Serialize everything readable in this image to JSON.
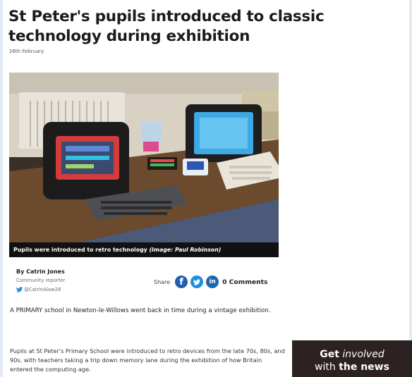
{
  "article": {
    "headline": "St Peter's pupils introduced to classic technology during exhibition",
    "date": "26th February",
    "caption_text": "Pupils were introduced to retro technology",
    "caption_credit": "(Image: Paul Robinson)",
    "author_name": "By Catrin Jones",
    "author_role": "Community reporter",
    "author_twitter": "@CatrinAlaw28",
    "share_label": "Share",
    "comments_label": "0 Comments",
    "paragraph_1": "A PRIMARY school in Newton-le-Willows went back in time during a vintage exhibition.",
    "paragraph_2": "Pupils at St Peter's Primary School were introduced to retro devices from the late 70s, 80s, and 90s, with teachers taking a trip down memory lane during the exhibition of how Britain entered the computing age."
  },
  "promo": {
    "get": "Get",
    "involved": "involved",
    "with": "with",
    "the_news": "the news"
  },
  "icons": {
    "facebook": "facebook-icon",
    "twitter": "twitter-icon",
    "linkedin": "linkedin-icon"
  },
  "colors": {
    "facebook": "#1f5fb0",
    "twitter": "#1f8fe0",
    "linkedin": "#1a67b0",
    "promo_bg": "#2b2221"
  }
}
